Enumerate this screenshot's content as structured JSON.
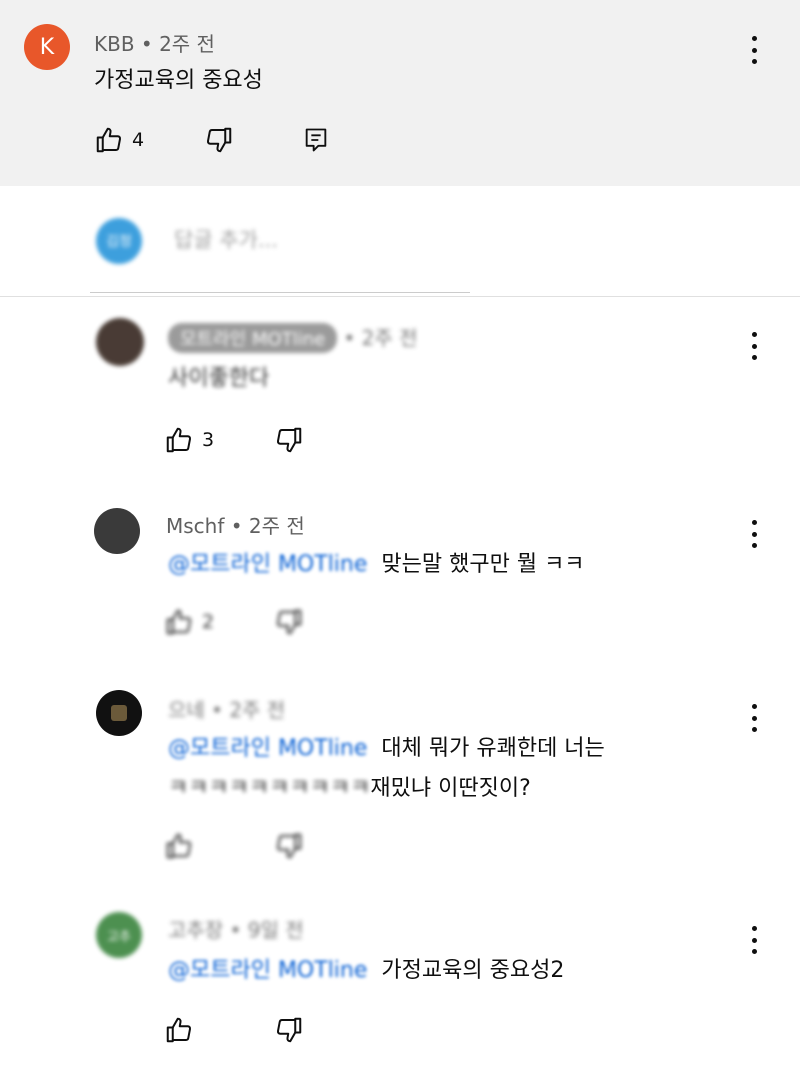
{
  "top_comment": {
    "avatar_letter": "K",
    "author": "KBB",
    "time": "2주 전",
    "text": "가정교육의 중요성",
    "likes": "4"
  },
  "reply_box": {
    "avatar_text": "김정",
    "placeholder": "답글 추가..."
  },
  "replies": [
    {
      "author": "모트라인 MOTline",
      "time": "2주 전",
      "text": "사이좋한다",
      "likes": "3"
    },
    {
      "author": "Mschf",
      "time": "2주 전",
      "mention": "@모트라인 MOTline",
      "text": "맞는말 했구만 뭘 ㅋㅋ",
      "likes": "2"
    },
    {
      "author": "으네",
      "time": "2주 전",
      "mention": "@모트라인 MOTline",
      "text": "대체 뭐가 유쾌한데 너는",
      "text2_blur": "ㅋㅋㅋㅋㅋㅋㅋㅋㅋㅋ",
      "text2": "재밌냐 이딴짓이?",
      "likes": ""
    },
    {
      "author": "고추장",
      "time": "9일 전",
      "mention": "@모트라인 MOTline",
      "text": "가정교육의 중요성2",
      "likes": "",
      "avatar_text": "고추"
    }
  ],
  "colors": {
    "top_bg": "#f1f1f1",
    "avatar_k": "#e8572a",
    "mention": "#065fd4",
    "reply_avatar": "#1c8fd8"
  },
  "icons": [
    "thumb-up-icon",
    "thumb-down-icon",
    "reply-icon",
    "more-vert-icon"
  ]
}
